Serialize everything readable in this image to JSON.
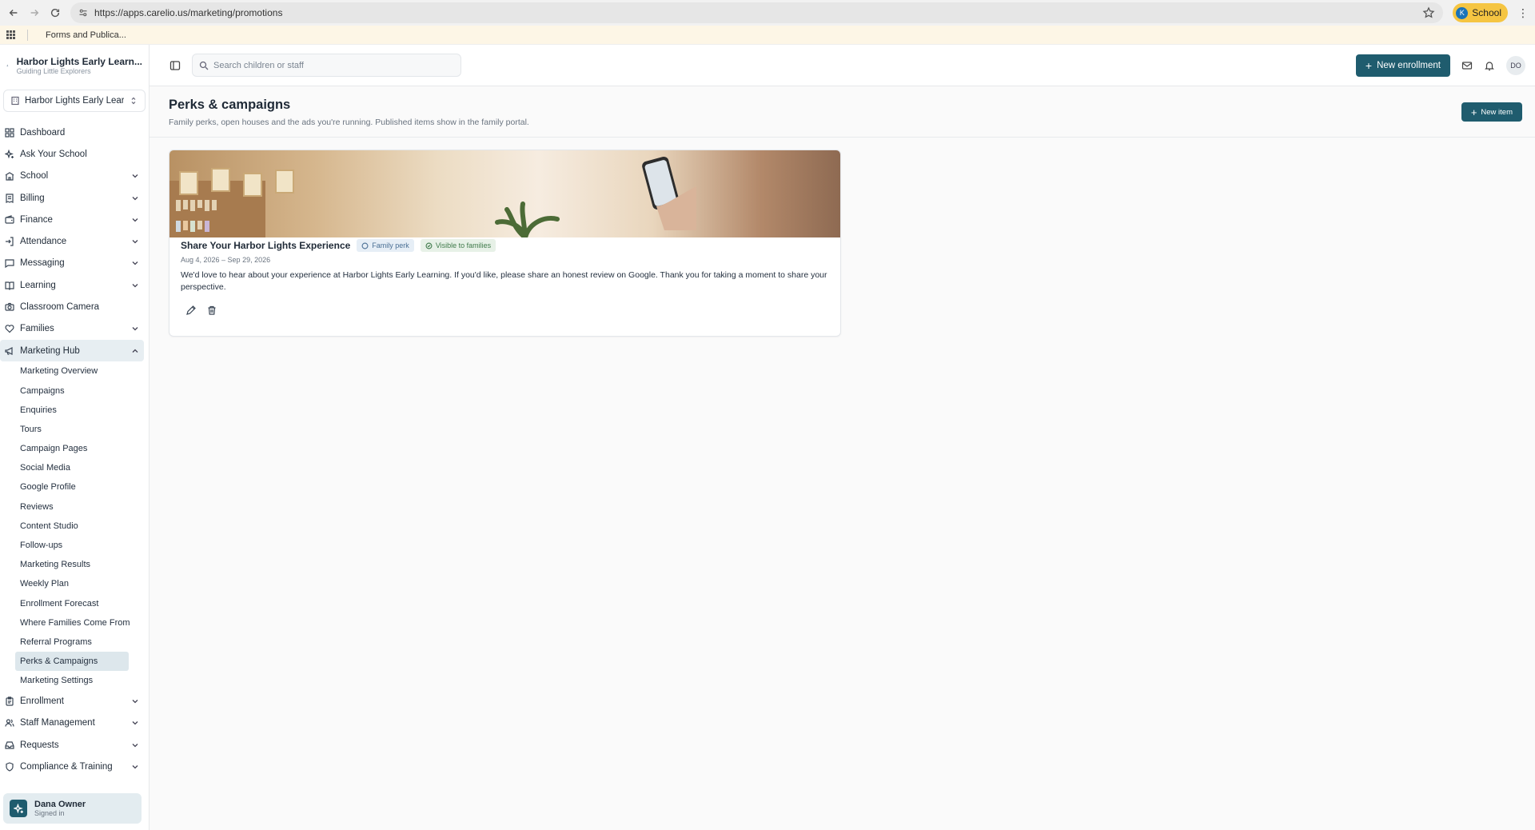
{
  "browser": {
    "url": "https://apps.carelio.us/marketing/promotions",
    "profile_initial": "K",
    "profile_label": "School",
    "bookmark": "Forms and Publica..."
  },
  "brand": {
    "name": "Harbor Lights Early Learn...",
    "tagline": "Guiding Little Explorers",
    "school_select": "Harbor Lights Early Lear..."
  },
  "nav": {
    "items": [
      {
        "label": "Dashboard"
      },
      {
        "label": "Ask Your School"
      },
      {
        "label": "School"
      },
      {
        "label": "Billing"
      },
      {
        "label": "Finance"
      },
      {
        "label": "Attendance"
      },
      {
        "label": "Messaging"
      },
      {
        "label": "Learning"
      },
      {
        "label": "Classroom Camera"
      },
      {
        "label": "Families"
      },
      {
        "label": "Marketing Hub"
      }
    ],
    "marketing_sub": [
      "Marketing Overview",
      "Campaigns",
      "Enquiries",
      "Tours",
      "Campaign Pages",
      "Social Media",
      "Google Profile",
      "Reviews",
      "Content Studio",
      "Follow-ups",
      "Marketing Results",
      "Weekly Plan",
      "Enrollment Forecast",
      "Where Families Come From",
      "Referral Programs",
      "Perks & Campaigns",
      "Marketing Settings"
    ],
    "after": [
      {
        "label": "Enrollment"
      },
      {
        "label": "Staff Management"
      },
      {
        "label": "Requests"
      },
      {
        "label": "Compliance & Training"
      }
    ]
  },
  "user": {
    "name": "Dana Owner",
    "status": "Signed in"
  },
  "topbar": {
    "search_placeholder": "Search children or staff",
    "new_enrollment": "New enrollment",
    "avatar_initials": "DO"
  },
  "page": {
    "title": "Perks & campaigns",
    "subtitle": "Family perks, open houses and the ads you're running. Published items show in the family portal.",
    "new_item": "New item"
  },
  "card": {
    "title": "Share Your Harbor Lights Experience",
    "badge_type": "Family perk",
    "badge_visibility": "Visible to families",
    "dates": "Aug 4, 2026 – Sep 29, 2026",
    "description": "We'd love to hear about your experience at Harbor Lights Early Learning. If you'd like, please share an honest review on Google. Thank you for taking a moment to share your perspective."
  }
}
